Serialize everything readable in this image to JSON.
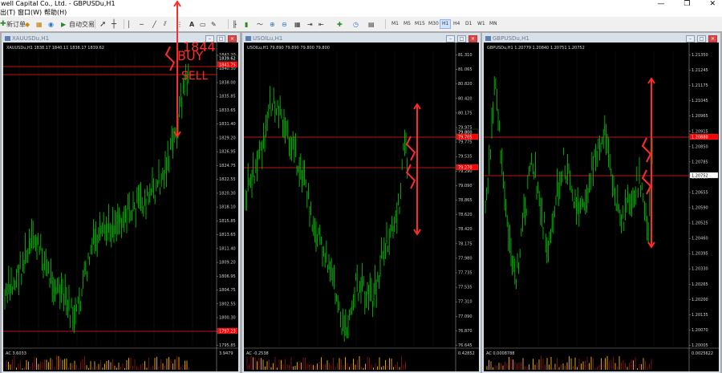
{
  "app": {
    "title": "well Capital Co., Ltd. - GBPUSDu,H1",
    "win_min": "—",
    "win_max": "❐",
    "win_close": "✕"
  },
  "menu": [
    "出(T)",
    "窗口(W)",
    "帮助(H)"
  ],
  "toolbar": {
    "new_order": "新订单",
    "autotrade": "自动交易",
    "timeframes": [
      "M1",
      "M5",
      "M15",
      "M30",
      "H1",
      "H4",
      "D1",
      "W1",
      "MN"
    ],
    "active_tf": "H1"
  },
  "charts": [
    {
      "title": "XAUUSDu,H1",
      "header": "XAUUSDu,H1  1838.17 1840.11 1838.17 1839.62",
      "price_labels": [
        "1842.20",
        "1840.30",
        "1838.00",
        "1835.85",
        "1833.65",
        "1831.40",
        "1829.20",
        "1826.95",
        "1824.75",
        "1822.55",
        "1820.30",
        "1818.10",
        "1815.85",
        "1813.65",
        "1811.40",
        "1809.20",
        "1806.95",
        "1804.75",
        "1802.55",
        "1800.30",
        "1798.10",
        "1795.85"
      ],
      "tags": [
        {
          "text": "1839.62",
          "color": "#ffffff",
          "bg": "#000000"
        },
        {
          "text": "1841.75",
          "color": "#ffffff",
          "bg": "#ff0000"
        },
        {
          "text": "1797.23",
          "color": "#ffffff",
          "bg": "#ff0000"
        }
      ],
      "indicator": {
        "label": "AC 3.6033",
        "scale": "3.9479"
      },
      "annotations": {
        "level": "1844",
        "buy": "BUY",
        "sell": "SELL"
      }
    },
    {
      "title": "USOILu,H1",
      "header": "USOILu,H1  79.890 79.890 79.800 79.800",
      "price_labels": [
        "81.310",
        "81.065",
        "80.820",
        "80.420",
        "80.175",
        "79.975",
        "79.775",
        "79.535",
        "79.290",
        "79.090",
        "78.865",
        "78.620",
        "78.420",
        "78.175",
        "77.980",
        "77.735",
        "77.535",
        "77.310",
        "77.090",
        "76.870",
        "76.645"
      ],
      "tags": [
        {
          "text": "79.800",
          "color": "#ffffff",
          "bg": "#000000"
        },
        {
          "text": "79.705",
          "color": "#ffffff",
          "bg": "#ff0000"
        },
        {
          "text": "79.270",
          "color": "#ffffff",
          "bg": "#ff0000"
        }
      ],
      "indicator": {
        "label": "AC -0.2538",
        "scale": "0.42852"
      }
    },
    {
      "title": "GBPUSDu,H1",
      "header": "GBPUSDu,H1  1.20779 1.20840 1.20751 1.20752",
      "price_labels": [
        "1.21350",
        "1.21245",
        "1.21175",
        "1.21045",
        "1.20965",
        "1.20915",
        "1.20850",
        "1.20785",
        "1.20720",
        "1.20655",
        "1.20590",
        "1.20525",
        "1.20460",
        "1.20395",
        "1.20330",
        "1.20265",
        "1.20200",
        "1.20135",
        "1.20070",
        "1.20005"
      ],
      "tags": [
        {
          "text": "1.20880",
          "color": "#ffffff",
          "bg": "#ff0000"
        },
        {
          "text": "1.20752",
          "color": "#000000",
          "bg": "#ffffff"
        }
      ],
      "indicator": {
        "label": "AC 0.0008788",
        "scale": "0.0025622"
      }
    }
  ],
  "colors": {
    "candle": "#00c000",
    "hline_red": "#ff1e1e",
    "arrow_red": "#ff2b2b",
    "grid": "#1e1e1e"
  }
}
